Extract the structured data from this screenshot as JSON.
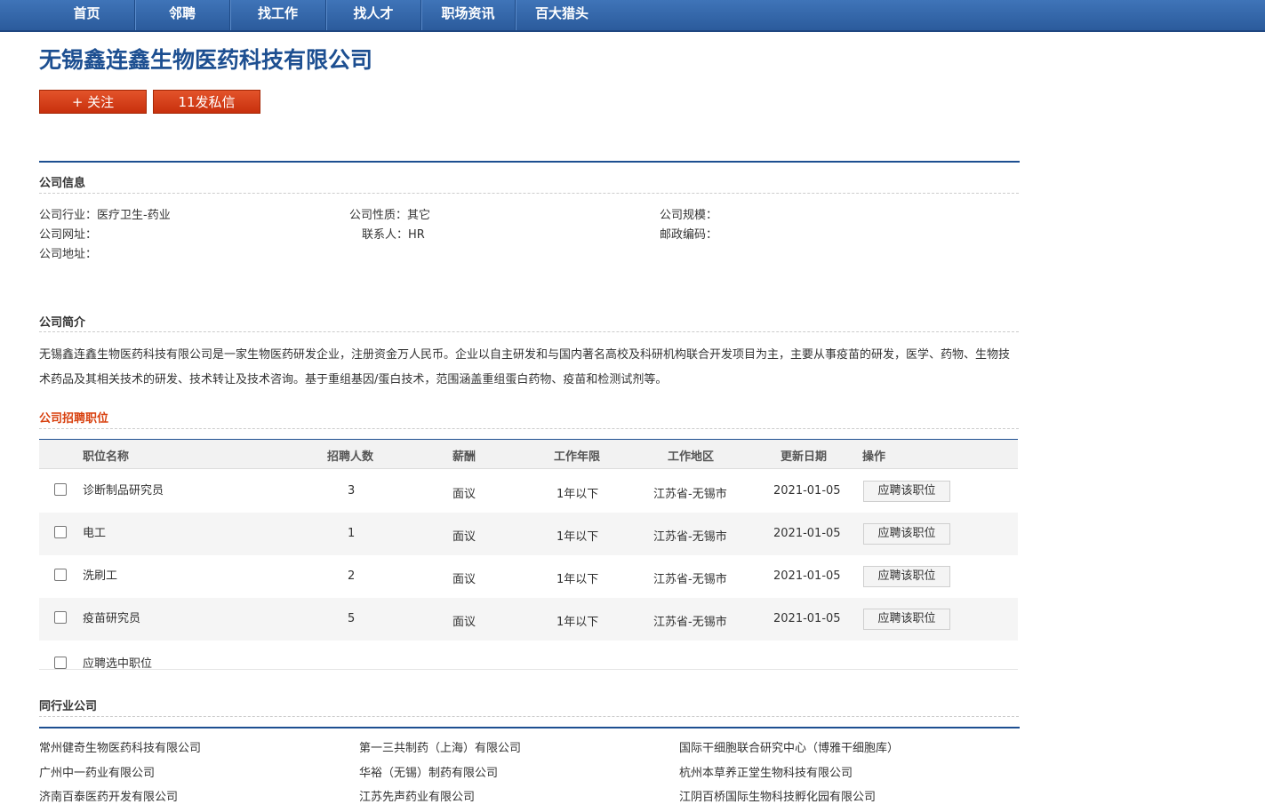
{
  "nav": {
    "items": [
      {
        "label": "首页"
      },
      {
        "label": "邻聘"
      },
      {
        "label": "找工作"
      },
      {
        "label": "找人才"
      },
      {
        "label": "职场资讯"
      },
      {
        "label": "百大猎头"
      }
    ]
  },
  "company": {
    "name": "无锡鑫连鑫生物医药科技有限公司",
    "follow_label": "+ 关注",
    "message_label": "11发私信"
  },
  "info": {
    "heading": "公司信息",
    "industry": "公司行业：医疗卫生-药业",
    "nature": "公司性质：其它",
    "scale": "公司规模：",
    "website": "公司网址：",
    "contact": "联系人：HR",
    "postcode": "邮政编码：",
    "address": "公司地址："
  },
  "intro": {
    "heading": "公司简介",
    "text": "无锡鑫连鑫生物医药科技有限公司是一家生物医药研发企业，注册资金万人民币。企业以自主研发和与国内著名高校及科研机构联合开发项目为主，主要从事疫苗的研发，医学、药物、生物技术药品及其相关技术的研发、技术转让及技术咨询。基于重组基因/蛋白技术，范围涵盖重组蛋白药物、疫苗和检测试剂等。"
  },
  "jobs": {
    "heading": "公司招聘职位",
    "columns": [
      "职位名称",
      "招聘人数",
      "薪酬",
      "工作年限",
      "工作地区",
      "更新日期",
      "操作"
    ],
    "rows": [
      {
        "title": "诊断制品研究员",
        "count": "3",
        "salary": "面议",
        "years": "1年以下",
        "area": "江苏省-无锡市",
        "date": "2021-01-05",
        "action": "应聘该职位"
      },
      {
        "title": "电工",
        "count": "1",
        "salary": "面议",
        "years": "1年以下",
        "area": "江苏省-无锡市",
        "date": "2021-01-05",
        "action": "应聘该职位"
      },
      {
        "title": "洗刷工",
        "count": "2",
        "salary": "面议",
        "years": "1年以下",
        "area": "江苏省-无锡市",
        "date": "2021-01-05",
        "action": "应聘该职位"
      },
      {
        "title": "疫苗研究员",
        "count": "5",
        "salary": "面议",
        "years": "1年以下",
        "area": "江苏省-无锡市",
        "date": "2021-01-05",
        "action": "应聘该职位"
      }
    ],
    "apply_selected": "应聘选中职位"
  },
  "peers": {
    "heading": "同行业公司",
    "companies": [
      "常州健奇生物医药科技有限公司",
      "第一三共制药（上海）有限公司",
      "国际干细胞联合研究中心（博雅干细胞库）",
      "广州中一药业有限公司",
      "华裕（无锡）制药有限公司",
      "杭州本草养正堂生物科技有限公司",
      "济南百泰医药开发有限公司",
      "江苏先声药业有限公司",
      "江阴百桥国际生物科技孵化园有限公司"
    ]
  },
  "colors": {
    "nav_bg": "#3a6db1",
    "title_blue": "#1d4f91",
    "button_red": "#d13e17",
    "section_red": "#d8400e"
  }
}
